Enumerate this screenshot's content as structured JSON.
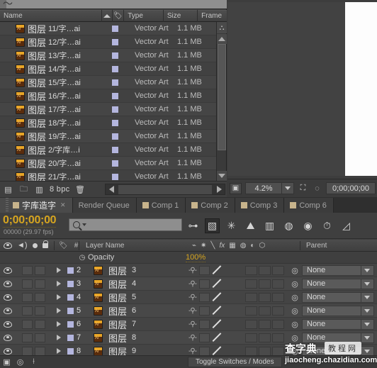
{
  "project_panel": {
    "columns": [
      {
        "key": "name",
        "label": "Name"
      },
      {
        "key": "sort",
        "label": ""
      },
      {
        "key": "tag",
        "label": ""
      },
      {
        "key": "type",
        "label": "Type"
      },
      {
        "key": "size",
        "label": "Size"
      },
      {
        "key": "frame",
        "label": "Frame"
      }
    ],
    "rows": [
      {
        "icon": "illustrator-file-icon",
        "name_cn": "图层",
        "name_rest": "11/字…ai",
        "type": "Vector Art",
        "size": "1.1 MB"
      },
      {
        "icon": "illustrator-file-icon",
        "name_cn": "图层",
        "name_rest": "12/字…ai",
        "type": "Vector Art",
        "size": "1.1 MB"
      },
      {
        "icon": "illustrator-file-icon",
        "name_cn": "图层",
        "name_rest": "13/字…ai",
        "type": "Vector Art",
        "size": "1.1 MB"
      },
      {
        "icon": "illustrator-file-icon",
        "name_cn": "图层",
        "name_rest": "14/字…ai",
        "type": "Vector Art",
        "size": "1.1 MB"
      },
      {
        "icon": "illustrator-file-icon",
        "name_cn": "图层",
        "name_rest": "15/字…ai",
        "type": "Vector Art",
        "size": "1.1 MB"
      },
      {
        "icon": "illustrator-file-icon",
        "name_cn": "图层",
        "name_rest": "16/字…ai",
        "type": "Vector Art",
        "size": "1.1 MB"
      },
      {
        "icon": "illustrator-file-icon",
        "name_cn": "图层",
        "name_rest": "17/字…ai",
        "type": "Vector Art",
        "size": "1.1 MB"
      },
      {
        "icon": "illustrator-file-icon",
        "name_cn": "图层",
        "name_rest": "18/字…ai",
        "type": "Vector Art",
        "size": "1.1 MB"
      },
      {
        "icon": "illustrator-file-icon",
        "name_cn": "图层",
        "name_rest": "19/字…ai",
        "type": "Vector Art",
        "size": "1.1 MB"
      },
      {
        "icon": "illustrator-file-icon",
        "name_cn": "图层",
        "name_rest": "2/字库…i",
        "type": "Vector Art",
        "size": "1.1 MB"
      },
      {
        "icon": "illustrator-file-icon",
        "name_cn": "图层",
        "name_rest": "20/字…ai",
        "type": "Vector Art",
        "size": "1.1 MB"
      },
      {
        "icon": "illustrator-file-icon",
        "name_cn": "图层",
        "name_rest": "21/字…ai",
        "type": "Vector Art",
        "size": "1.1 MB"
      }
    ],
    "footer": {
      "new_comp_icon": "new-composition-icon",
      "new_folder_icon": "new-folder-icon",
      "footage_icon": "interpret-footage-icon",
      "bpc_label": "8 bpc",
      "delete_icon": "trash-icon"
    }
  },
  "viewer": {
    "fit_icon": "always-preview-icon",
    "zoom_level": "4.2%",
    "zoom_dropdown_icon": "chevron-down-icon",
    "region_of_interest_icon": "region-of-interest-icon",
    "mask_icon": "toggle-mask-icon",
    "timecode": "0;00;00;00"
  },
  "tabs": [
    {
      "label": "字库造字",
      "active": true,
      "closable": true,
      "has_square": true
    },
    {
      "label": "Render Queue",
      "active": false,
      "closable": false,
      "has_square": false
    },
    {
      "label": "Comp 1",
      "active": false,
      "closable": false,
      "has_square": true
    },
    {
      "label": "Comp 2",
      "active": false,
      "closable": false,
      "has_square": true
    },
    {
      "label": "Comp 3",
      "active": false,
      "closable": false,
      "has_square": true
    },
    {
      "label": "Comp 6",
      "active": false,
      "closable": false,
      "has_square": true
    }
  ],
  "timeline": {
    "current_time": "0;00;00;00",
    "frame_info": "00000 (29.97 fps)",
    "search_placeholder": "",
    "search_value": "",
    "search_icon": "search-icon",
    "toolbar_icons": [
      "composition-mini-flowchart-icon",
      "draft-3d-icon",
      "hide-shy-layers-icon",
      "motion-blur-icon",
      "graph-editor-icon",
      "frame-blending-icon",
      "brainstorm-icon",
      "auto-keyframe-icon"
    ],
    "column_headers": {
      "video_icon": "eye-icon",
      "audio_icon": "speaker-icon",
      "solo_icon": "solo-icon",
      "lock_icon": "lock-icon",
      "label_icon": "label-tag-icon",
      "number_label": "#",
      "layer_name_label": "Layer Name",
      "switch_icons": [
        "shy-icon",
        "collapse-transform-icon",
        "quality-icon",
        "effects-icon",
        "frame-blend-icon",
        "motion-blur-icon",
        "adjustment-layer-icon",
        "3d-layer-icon"
      ],
      "parent_label": "Parent"
    },
    "property_row": {
      "stopwatch_icon": "stopwatch-icon",
      "label": "Opacity",
      "value": "100%"
    },
    "layers": [
      {
        "index": "2",
        "name_cn": "图层",
        "name_num": "3",
        "parent": "None"
      },
      {
        "index": "3",
        "name_cn": "图层",
        "name_num": "4",
        "parent": "None"
      },
      {
        "index": "4",
        "name_cn": "图层",
        "name_num": "5",
        "parent": "None"
      },
      {
        "index": "5",
        "name_cn": "图层",
        "name_num": "6",
        "parent": "None"
      },
      {
        "index": "6",
        "name_cn": "图层",
        "name_num": "7",
        "parent": "None"
      },
      {
        "index": "7",
        "name_cn": "图层",
        "name_num": "8",
        "parent": "None"
      },
      {
        "index": "8",
        "name_cn": "图层",
        "name_num": "9",
        "parent": "None"
      }
    ],
    "footer": {
      "icons": [
        "toggle-switches-modes-icon",
        "graph-editor-icon",
        "stretch-icon"
      ],
      "toggle_label": "Toggle Switches / Modes"
    }
  },
  "watermark": {
    "brand_cn": "查字典",
    "brand_pill": "教程网",
    "url": "jiaocheng.chazidian.com"
  },
  "colors": {
    "accent_orange": "#d6a520",
    "label_purple": "#b4b6de",
    "panel_bg": "#424242",
    "tab_active": "#4a4a4a"
  }
}
